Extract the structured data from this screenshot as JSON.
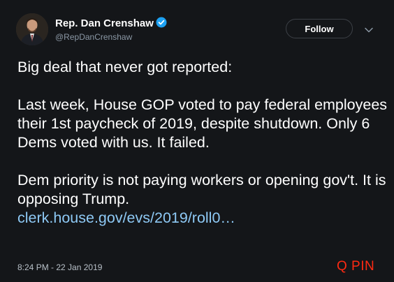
{
  "header": {
    "display_name": "Rep. Dan Crenshaw",
    "handle": "@RepDanCrenshaw",
    "follow_label": "Follow",
    "verified_icon": "verified-badge-icon",
    "more_icon": "chevron-down-icon"
  },
  "tweet": {
    "line_1": "Big deal that never got reported:",
    "paragraph_2": "Last week, House GOP voted to pay federal employees their 1st paycheck of 2019, despite shutdown. Only 6 Dems voted with us. It failed.",
    "paragraph_3": "Dem priority is not paying workers or opening gov't. It is opposing Trump.",
    "link_text": "clerk.house.gov/evs/2019/roll0…"
  },
  "footer": {
    "timestamp": "8:24 PM - 22 Jan 2019",
    "watermark": "Q PIN"
  },
  "colors": {
    "background": "#141619",
    "text": "#ffffff",
    "secondary_text": "#8b98a5",
    "link": "#8ec9f5",
    "verified": "#1da1f2",
    "watermark": "#ff2a12"
  }
}
